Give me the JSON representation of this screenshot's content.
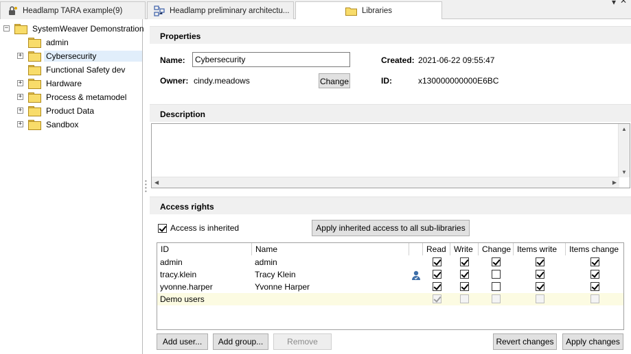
{
  "tabs": [
    {
      "label": "Headlamp TARA example(9)",
      "icon": "lock-icon"
    },
    {
      "label": "Headlamp preliminary architectu...",
      "icon": "architecture-icon"
    },
    {
      "label": "Libraries",
      "icon": "folder-icon",
      "active": true
    }
  ],
  "window": {
    "close_glyph": "✕",
    "menu_glyph": "▾"
  },
  "tree": {
    "root": {
      "label": "SystemWeaver Demonstration",
      "expander": "−"
    },
    "items": [
      {
        "label": "admin",
        "expander": ""
      },
      {
        "label": "Cybersecurity",
        "expander": "+",
        "selected": true
      },
      {
        "label": "Functional Safety dev",
        "expander": ""
      },
      {
        "label": "Hardware",
        "expander": "+"
      },
      {
        "label": "Process & metamodel",
        "expander": "+"
      },
      {
        "label": "Product Data",
        "expander": "+"
      },
      {
        "label": "Sandbox",
        "expander": "+"
      }
    ]
  },
  "properties": {
    "heading": "Properties",
    "name_label": "Name:",
    "name_value": "Cybersecurity",
    "owner_label": "Owner:",
    "owner_value": "cindy.meadows",
    "change_button": "Change",
    "created_label": "Created:",
    "created_value": "2021-06-22 09:55:47",
    "id_label": "ID:",
    "id_value": "x130000000000E6BC"
  },
  "description": {
    "heading": "Description",
    "value": ""
  },
  "access": {
    "heading": "Access rights",
    "inherited_label": "Access is inherited",
    "inherited_checked": true,
    "apply_inherited_button": "Apply inherited access to all sub-libraries",
    "columns": [
      "ID",
      "Name",
      "",
      "Read",
      "Write",
      "Change",
      "Items write",
      "Items change"
    ],
    "rows": [
      {
        "id": "admin",
        "name": "admin",
        "user_icon": false,
        "perms": [
          true,
          true,
          true,
          true,
          true
        ],
        "dim": false
      },
      {
        "id": "tracy.klein",
        "name": "Tracy Klein",
        "user_icon": true,
        "perms": [
          true,
          true,
          false,
          true,
          true
        ],
        "dim": false
      },
      {
        "id": "yvonne.harper",
        "name": "Yvonne Harper",
        "user_icon": false,
        "perms": [
          true,
          true,
          false,
          true,
          true
        ],
        "dim": false
      },
      {
        "id": "Demo users",
        "name": "",
        "user_icon": false,
        "perms": [
          true,
          false,
          false,
          false,
          false
        ],
        "dim": true
      }
    ],
    "add_user_button": "Add user...",
    "add_group_button": "Add group...",
    "remove_button": "Remove",
    "revert_button": "Revert changes",
    "apply_button": "Apply changes"
  },
  "colors": {
    "selection": "#e1eefb",
    "group_row": "#fcfbe2",
    "section_bg": "#f0f0f0",
    "folder": "#f8dc6a"
  }
}
